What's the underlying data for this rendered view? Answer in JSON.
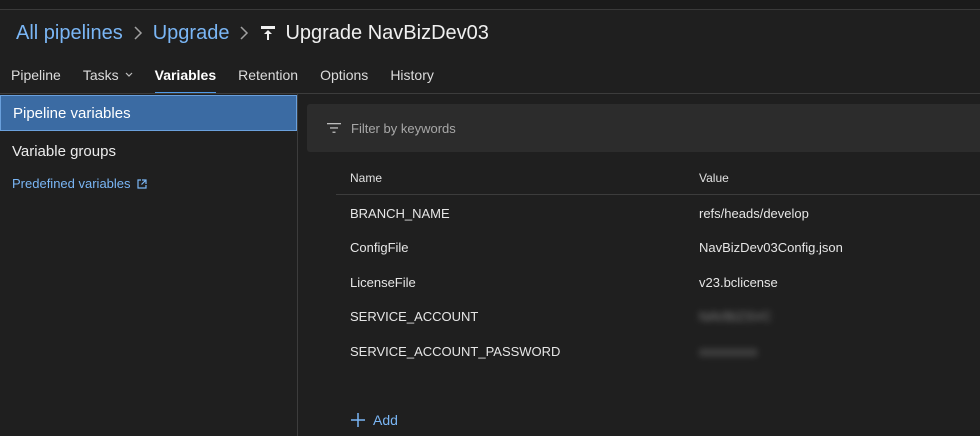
{
  "breadcrumb": {
    "root": "All pipelines",
    "parent": "Upgrade",
    "current": "Upgrade NavBizDev03"
  },
  "tabs": [
    {
      "label": "Pipeline"
    },
    {
      "label": "Tasks"
    },
    {
      "label": "Variables",
      "active": true
    },
    {
      "label": "Retention"
    },
    {
      "label": "Options"
    },
    {
      "label": "History"
    }
  ],
  "sidebar": {
    "items": [
      {
        "label": "Pipeline variables",
        "selected": true
      },
      {
        "label": "Variable groups"
      }
    ],
    "link": "Predefined variables"
  },
  "filter": {
    "placeholder": "Filter by keywords"
  },
  "table": {
    "columns": [
      "Name",
      "Value"
    ],
    "rows": [
      {
        "name": "BRANCH_NAME",
        "value": "refs/heads/develop"
      },
      {
        "name": "ConfigFile",
        "value": "NavBizDev03Config.json"
      },
      {
        "name": "LicenseFile",
        "value": "v23.bclicense"
      },
      {
        "name": "SERVICE_ACCOUNT",
        "value": "NAVBIZSVC",
        "hidden": true
      },
      {
        "name": "SERVICE_ACCOUNT_PASSWORD",
        "value": "xxxxxxxxx",
        "hidden": true
      }
    ]
  },
  "actions": {
    "add_label": "Add"
  },
  "colors": {
    "accent": "#7ab6f5",
    "selected_bg": "#3b6ba3",
    "background": "#1f1f1f",
    "filter_bg": "#2c2c2c"
  }
}
